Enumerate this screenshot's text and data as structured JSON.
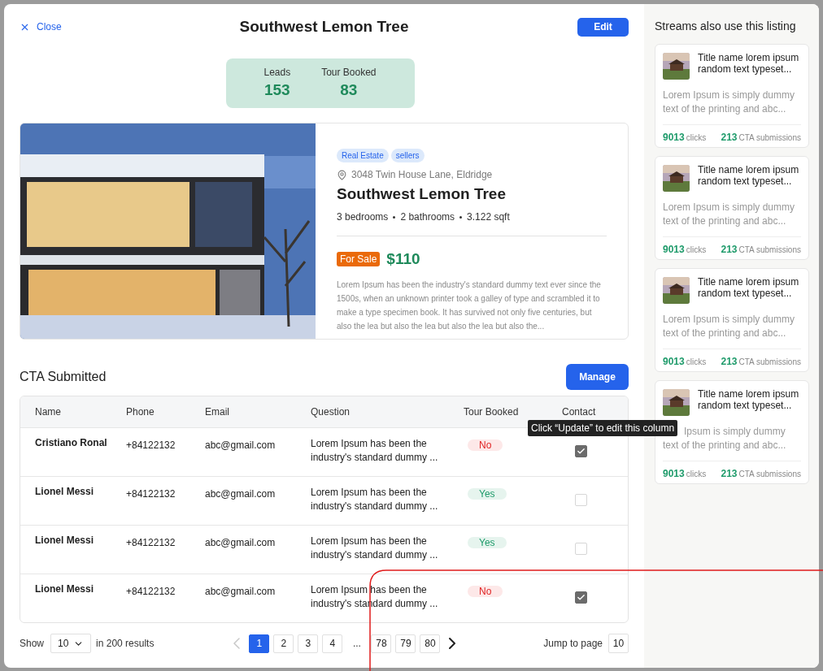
{
  "header": {
    "close": "Close",
    "title": "Southwest Lemon Tree",
    "edit": "Edit"
  },
  "stats": [
    {
      "label": "Leads",
      "value": "153"
    },
    {
      "label": "Tour Booked",
      "value": "83"
    }
  ],
  "listing": {
    "tags": [
      "Real Estate",
      "sellers"
    ],
    "address": "3048 Twin House Lane, Eldridge",
    "title": "Southwest Lemon Tree",
    "features": [
      "3 bedrooms",
      "2 bathrooms",
      "3.122 sqft"
    ],
    "status": "For Sale",
    "price": "$110",
    "description": "Lorem Ipsum has been the industry's standard dummy text ever since the 1500s, when an unknown printer took a galley of type and scrambled it to make a type specimen book. It has survived not only five centuries, but also the lea but also the lea but also the lea but also the..."
  },
  "cta": {
    "title": "CTA Submitted",
    "manage": "Manage",
    "columns": [
      "Name",
      "Phone",
      "Email",
      "Question",
      "Tour Booked",
      "Contact"
    ],
    "rows": [
      {
        "name": "Cristiano Ronal",
        "phone": "+84122132",
        "email": "abc@gmail.com",
        "question": "Lorem Ipsum has been the industry's standard dummy ...",
        "tour_booked": "No",
        "booked": false,
        "contact": true
      },
      {
        "name": "Lionel Messi",
        "phone": "+84122132",
        "email": "abc@gmail.com",
        "question": "Lorem Ipsum has been the industry's standard dummy ...",
        "tour_booked": "Yes",
        "booked": true,
        "contact": false
      },
      {
        "name": "Lionel Messi",
        "phone": "+84122132",
        "email": "abc@gmail.com",
        "question": "Lorem Ipsum has been the industry's standard dummy ...",
        "tour_booked": "Yes",
        "booked": true,
        "contact": false
      },
      {
        "name": "Lionel Messi",
        "phone": "+84122132",
        "email": "abc@gmail.com",
        "question": "Lorem Ipsum has been the industry's standard dummy ...",
        "tour_booked": "No",
        "booked": false,
        "contact": true
      }
    ],
    "tooltip": "Click “Update” to edit this column"
  },
  "pagination": {
    "show_label": "Show",
    "page_size": "10",
    "results": "in 200 results",
    "pages": [
      {
        "label": "1",
        "kind": "page",
        "selected": true
      },
      {
        "label": "2",
        "kind": "page",
        "selected": false
      },
      {
        "label": "3",
        "kind": "page",
        "selected": false
      },
      {
        "label": "4",
        "kind": "page",
        "selected": false
      },
      {
        "label": "...",
        "kind": "ellipsis",
        "selected": false
      },
      {
        "label": "78",
        "kind": "page",
        "selected": false
      },
      {
        "label": "79",
        "kind": "page",
        "selected": false
      },
      {
        "label": "80",
        "kind": "page",
        "selected": false
      }
    ],
    "jump_label": "Jump to page",
    "jump_value": "10"
  },
  "sidebar": {
    "title": "Streams also use this listing",
    "cards": [
      {
        "title": "Title name lorem ipsum random text typeset...",
        "description": "Lorem Ipsum is simply dummy text of the printing and abc...",
        "covered": false,
        "clicks": "9013",
        "clicks_label": "clicks",
        "submissions": "213",
        "submissions_label": "CTA submissions"
      },
      {
        "title": "Title name lorem ipsum random text typeset...",
        "description": "Lorem Ipsum is simply dummy text of the printing and abc...",
        "covered": false,
        "clicks": "9013",
        "clicks_label": "clicks",
        "submissions": "213",
        "submissions_label": "CTA submissions"
      },
      {
        "title": "Title name lorem ipsum random text typeset...",
        "description": "Lorem Ipsum is simply dummy text of the printing and abc...",
        "covered": false,
        "clicks": "9013",
        "clicks_label": "clicks",
        "submissions": "213",
        "submissions_label": "CTA submissions"
      },
      {
        "title": "Title name lorem ipsum random text typeset...",
        "description": "Ipsum is simply dummy text of the printing and abc...",
        "covered": true,
        "clicks": "9013",
        "clicks_label": "clicks",
        "submissions": "213",
        "submissions_label": "CTA submissions"
      }
    ]
  }
}
